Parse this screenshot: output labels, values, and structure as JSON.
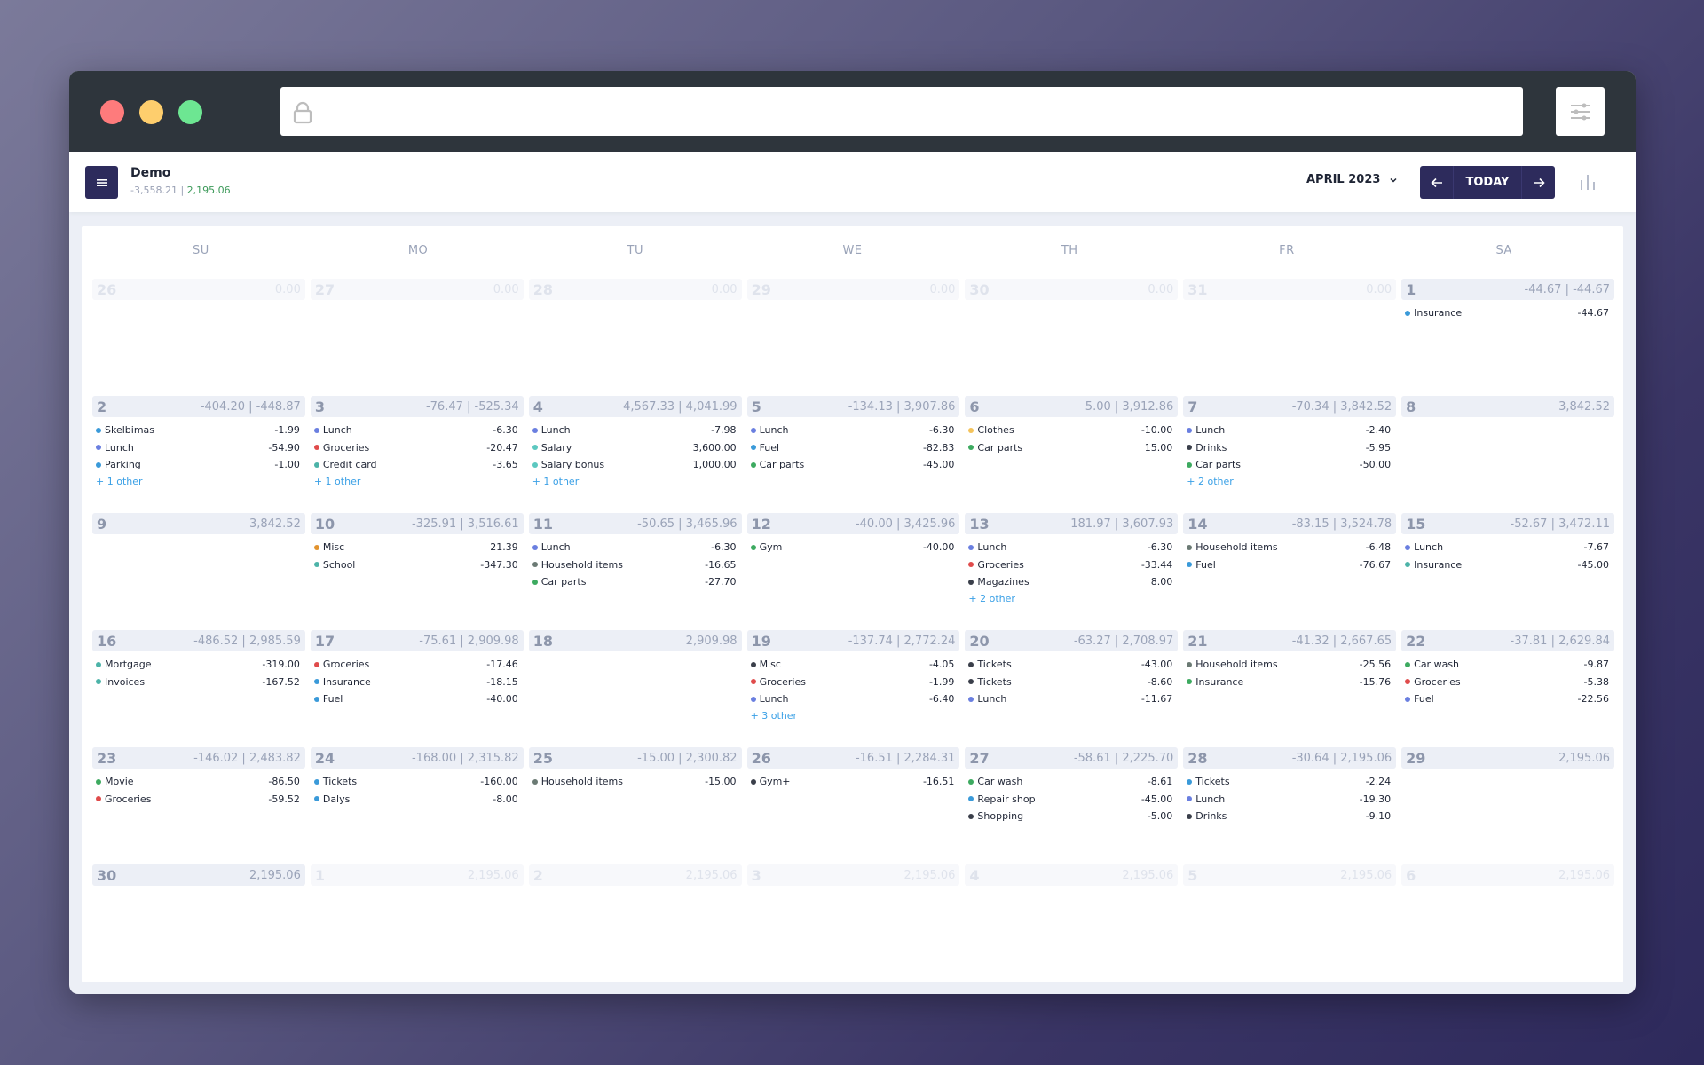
{
  "window": {
    "url": "",
    "traffic_lights": [
      "close",
      "minimize",
      "maximize"
    ]
  },
  "header": {
    "account_name": "Demo",
    "account_change": "-3,558.21",
    "separator": " | ",
    "account_balance": "2,195.06",
    "month_label": "APRIL 2023",
    "today_label": "TODAY",
    "prev_icon": "arrow-left-icon",
    "next_icon": "arrow-right-icon"
  },
  "colors": {
    "primary": "#2d2b5c",
    "positive": "#3d9a5a",
    "link": "#3aa0e6",
    "cat_blue": "#3a9ad9",
    "cat_indigo": "#6a7fe0",
    "cat_teal": "#4cb3a8",
    "cat_green": "#3daa60",
    "cat_red": "#e04b4b",
    "cat_orange": "#e2932e",
    "cat_yellow": "#f4c35b",
    "cat_dark": "#3a3f4a",
    "cat_gray": "#6b7a74"
  },
  "calendar": {
    "weekdays": [
      "SU",
      "MO",
      "TU",
      "WE",
      "TH",
      "FR",
      "SA"
    ],
    "weeks": [
      [
        {
          "num": "26",
          "total": "0.00",
          "other": true,
          "tx": []
        },
        {
          "num": "27",
          "total": "0.00",
          "other": true,
          "tx": []
        },
        {
          "num": "28",
          "total": "0.00",
          "other": true,
          "tx": []
        },
        {
          "num": "29",
          "total": "0.00",
          "other": true,
          "tx": []
        },
        {
          "num": "30",
          "total": "0.00",
          "other": true,
          "tx": []
        },
        {
          "num": "31",
          "total": "0.00",
          "other": true,
          "tx": []
        },
        {
          "num": "1",
          "total": "-44.67 | -44.67",
          "tx": [
            {
              "name": "Insurance",
              "amount": "-44.67",
              "color": "#3a9ad9"
            }
          ]
        }
      ],
      [
        {
          "num": "2",
          "total": "-404.20 | -448.87",
          "tx": [
            {
              "name": "Skelbimas",
              "amount": "-1.99",
              "color": "#3a9ad9"
            },
            {
              "name": "Lunch",
              "amount": "-54.90",
              "color": "#6a7fe0"
            },
            {
              "name": "Parking",
              "amount": "-1.00",
              "color": "#3a9ad9"
            }
          ],
          "more": "+ 1 other"
        },
        {
          "num": "3",
          "total": "-76.47 | -525.34",
          "tx": [
            {
              "name": "Lunch",
              "amount": "-6.30",
              "color": "#6a7fe0"
            },
            {
              "name": "Groceries",
              "amount": "-20.47",
              "color": "#e04b4b"
            },
            {
              "name": "Credit card",
              "amount": "-3.65",
              "color": "#4cb3a8"
            }
          ],
          "more": "+ 1 other"
        },
        {
          "num": "4",
          "total": "4,567.33 | 4,041.99",
          "tx": [
            {
              "name": "Lunch",
              "amount": "-7.98",
              "color": "#6a7fe0"
            },
            {
              "name": "Salary",
              "amount": "3,600.00",
              "color": "#5cc8c0"
            },
            {
              "name": "Salary bonus",
              "amount": "1,000.00",
              "color": "#5cc8c0"
            }
          ],
          "more": "+ 1 other"
        },
        {
          "num": "5",
          "total": "-134.13 | 3,907.86",
          "tx": [
            {
              "name": "Lunch",
              "amount": "-6.30",
              "color": "#6a7fe0"
            },
            {
              "name": "Fuel",
              "amount": "-82.83",
              "color": "#3a9ad9"
            },
            {
              "name": "Car parts",
              "amount": "-45.00",
              "color": "#3daa60"
            }
          ]
        },
        {
          "num": "6",
          "total": "5.00 | 3,912.86",
          "tx": [
            {
              "name": "Clothes",
              "amount": "-10.00",
              "color": "#f4c35b"
            },
            {
              "name": "Car parts",
              "amount": "15.00",
              "color": "#3daa60"
            }
          ]
        },
        {
          "num": "7",
          "total": "-70.34 | 3,842.52",
          "tx": [
            {
              "name": "Lunch",
              "amount": "-2.40",
              "color": "#6a7fe0"
            },
            {
              "name": "Drinks",
              "amount": "-5.95",
              "color": "#3a3f4a"
            },
            {
              "name": "Car parts",
              "amount": "-50.00",
              "color": "#3daa60"
            }
          ],
          "more": "+ 2 other"
        },
        {
          "num": "8",
          "total": "3,842.52",
          "tx": []
        }
      ],
      [
        {
          "num": "9",
          "total": "3,842.52",
          "tx": []
        },
        {
          "num": "10",
          "total": "-325.91 | 3,516.61",
          "tx": [
            {
              "name": "Misc",
              "amount": "21.39",
              "color": "#e2932e"
            },
            {
              "name": "School",
              "amount": "-347.30",
              "color": "#4cb3a8"
            }
          ]
        },
        {
          "num": "11",
          "total": "-50.65 | 3,465.96",
          "tx": [
            {
              "name": "Lunch",
              "amount": "-6.30",
              "color": "#6a7fe0"
            },
            {
              "name": "Household items",
              "amount": "-16.65",
              "color": "#6b7a74"
            },
            {
              "name": "Car parts",
              "amount": "-27.70",
              "color": "#3daa60"
            }
          ]
        },
        {
          "num": "12",
          "total": "-40.00 | 3,425.96",
          "tx": [
            {
              "name": "Gym",
              "amount": "-40.00",
              "color": "#3daa60"
            }
          ]
        },
        {
          "num": "13",
          "total": "181.97 | 3,607.93",
          "tx": [
            {
              "name": "Lunch",
              "amount": "-6.30",
              "color": "#6a7fe0"
            },
            {
              "name": "Groceries",
              "amount": "-33.44",
              "color": "#e04b4b"
            },
            {
              "name": "Magazines",
              "amount": "8.00",
              "color": "#3a3f4a"
            }
          ],
          "more": "+ 2 other"
        },
        {
          "num": "14",
          "total": "-83.15 | 3,524.78",
          "tx": [
            {
              "name": "Household items",
              "amount": "-6.48",
              "color": "#6b7a74"
            },
            {
              "name": "Fuel",
              "amount": "-76.67",
              "color": "#3a9ad9"
            }
          ]
        },
        {
          "num": "15",
          "total": "-52.67 | 3,472.11",
          "tx": [
            {
              "name": "Lunch",
              "amount": "-7.67",
              "color": "#6a7fe0"
            },
            {
              "name": "Insurance",
              "amount": "-45.00",
              "color": "#4cb3a8"
            }
          ]
        }
      ],
      [
        {
          "num": "16",
          "total": "-486.52 | 2,985.59",
          "tx": [
            {
              "name": "Mortgage",
              "amount": "-319.00",
              "color": "#4cb3a8"
            },
            {
              "name": "Invoices",
              "amount": "-167.52",
              "color": "#4cb3a8"
            }
          ]
        },
        {
          "num": "17",
          "total": "-75.61 | 2,909.98",
          "tx": [
            {
              "name": "Groceries",
              "amount": "-17.46",
              "color": "#e04b4b"
            },
            {
              "name": "Insurance",
              "amount": "-18.15",
              "color": "#3a9ad9"
            },
            {
              "name": "Fuel",
              "amount": "-40.00",
              "color": "#3a9ad9"
            }
          ]
        },
        {
          "num": "18",
          "total": "2,909.98",
          "tx": []
        },
        {
          "num": "19",
          "total": "-137.74 | 2,772.24",
          "tx": [
            {
              "name": "Misc",
              "amount": "-4.05",
              "color": "#3a3f4a"
            },
            {
              "name": "Groceries",
              "amount": "-1.99",
              "color": "#e04b4b"
            },
            {
              "name": "Lunch",
              "amount": "-6.40",
              "color": "#6a7fe0"
            }
          ],
          "more": "+ 3 other"
        },
        {
          "num": "20",
          "total": "-63.27 | 2,708.97",
          "tx": [
            {
              "name": "Tickets",
              "amount": "-43.00",
              "color": "#3a3f4a"
            },
            {
              "name": "Tickets",
              "amount": "-8.60",
              "color": "#3a3f4a"
            },
            {
              "name": "Lunch",
              "amount": "-11.67",
              "color": "#6a7fe0"
            }
          ]
        },
        {
          "num": "21",
          "total": "-41.32 | 2,667.65",
          "tx": [
            {
              "name": "Household items",
              "amount": "-25.56",
              "color": "#6b7a74"
            },
            {
              "name": "Insurance",
              "amount": "-15.76",
              "color": "#3daa60"
            }
          ]
        },
        {
          "num": "22",
          "total": "-37.81 | 2,629.84",
          "tx": [
            {
              "name": "Car wash",
              "amount": "-9.87",
              "color": "#3daa60"
            },
            {
              "name": "Groceries",
              "amount": "-5.38",
              "color": "#e04b4b"
            },
            {
              "name": "Fuel",
              "amount": "-22.56",
              "color": "#6a7fe0"
            }
          ]
        }
      ],
      [
        {
          "num": "23",
          "total": "-146.02 | 2,483.82",
          "tx": [
            {
              "name": "Movie",
              "amount": "-86.50",
              "color": "#3daa60"
            },
            {
              "name": "Groceries",
              "amount": "-59.52",
              "color": "#e04b4b"
            }
          ]
        },
        {
          "num": "24",
          "total": "-168.00 | 2,315.82",
          "tx": [
            {
              "name": "Tickets",
              "amount": "-160.00",
              "color": "#3a9ad9"
            },
            {
              "name": "Dalys",
              "amount": "-8.00",
              "color": "#3a9ad9"
            }
          ]
        },
        {
          "num": "25",
          "total": "-15.00 | 2,300.82",
          "tx": [
            {
              "name": "Household items",
              "amount": "-15.00",
              "color": "#6b7a74"
            }
          ]
        },
        {
          "num": "26",
          "total": "-16.51 | 2,284.31",
          "tx": [
            {
              "name": "Gym+",
              "amount": "-16.51",
              "color": "#3a3f4a"
            }
          ]
        },
        {
          "num": "27",
          "total": "-58.61 | 2,225.70",
          "tx": [
            {
              "name": "Car wash",
              "amount": "-8.61",
              "color": "#3daa60"
            },
            {
              "name": "Repair shop",
              "amount": "-45.00",
              "color": "#3a9ad9"
            },
            {
              "name": "Shopping",
              "amount": "-5.00",
              "color": "#3a3f4a"
            }
          ]
        },
        {
          "num": "28",
          "total": "-30.64 | 2,195.06",
          "tx": [
            {
              "name": "Tickets",
              "amount": "-2.24",
              "color": "#3a9ad9"
            },
            {
              "name": "Lunch",
              "amount": "-19.30",
              "color": "#6a7fe0"
            },
            {
              "name": "Drinks",
              "amount": "-9.10",
              "color": "#3a3f4a"
            }
          ]
        },
        {
          "num": "29",
          "total": "2,195.06",
          "tx": []
        }
      ],
      [
        {
          "num": "30",
          "total": "2,195.06",
          "tx": []
        },
        {
          "num": "1",
          "total": "2,195.06",
          "other": true,
          "tx": []
        },
        {
          "num": "2",
          "total": "2,195.06",
          "other": true,
          "tx": []
        },
        {
          "num": "3",
          "total": "2,195.06",
          "other": true,
          "tx": []
        },
        {
          "num": "4",
          "total": "2,195.06",
          "other": true,
          "tx": []
        },
        {
          "num": "5",
          "total": "2,195.06",
          "other": true,
          "tx": []
        },
        {
          "num": "6",
          "total": "2,195.06",
          "other": true,
          "tx": []
        }
      ]
    ]
  }
}
